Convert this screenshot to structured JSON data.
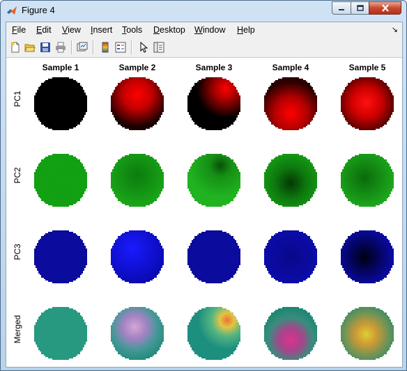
{
  "window": {
    "title": "Figure 4"
  },
  "menubar": {
    "items": [
      "File",
      "Edit",
      "View",
      "Insert",
      "Tools",
      "Desktop",
      "Window",
      "Help"
    ]
  },
  "toolbar": {
    "icons": [
      "new-figure-icon",
      "open-file-icon",
      "save-icon",
      "print-icon",
      "link-plot-icon",
      "colorbar-icon",
      "legend-icon",
      "pointer-icon",
      "property-editor-icon"
    ]
  },
  "figure": {
    "column_titles": [
      "Sample 1",
      "Sample 2",
      "Sample 3",
      "Sample 4",
      "Sample 5"
    ],
    "row_labels": [
      "PC1",
      "PC2",
      "PC3",
      "Merged"
    ]
  },
  "colors": {
    "red_channel": "#ff0000",
    "green_channel": "#1fb21f",
    "blue_channel": "#0a0aa5",
    "merged_base": "#2aa07a"
  }
}
